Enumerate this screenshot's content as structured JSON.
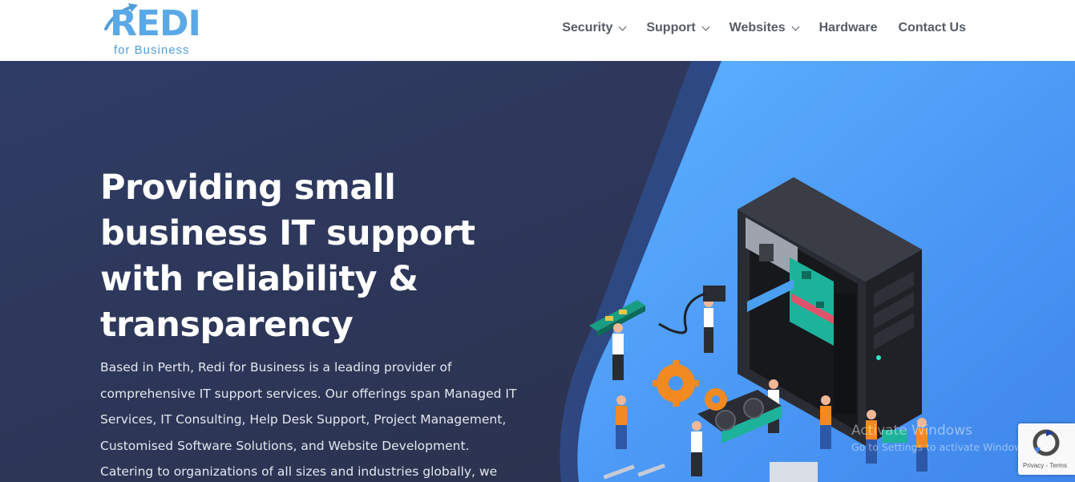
{
  "brand": {
    "name": "REDI",
    "tagline": "for Business"
  },
  "nav": {
    "items": [
      {
        "label": "Security",
        "has_dropdown": true
      },
      {
        "label": "Support",
        "has_dropdown": true
      },
      {
        "label": "Websites",
        "has_dropdown": true
      },
      {
        "label": "Hardware",
        "has_dropdown": false
      },
      {
        "label": "Contact Us",
        "has_dropdown": false
      }
    ]
  },
  "hero": {
    "title_lines": [
      "Providing small",
      "business IT support",
      "with reliability &",
      "transparency"
    ],
    "desc_lines": [
      "Based in Perth, Redi for Business is a leading provider of",
      "comprehensive IT support services. Our offerings span Managed IT",
      "Services, IT Consulting, Help Desk Support, Project Management,",
      "Customised Software Solutions, and Website Development.",
      "Catering to organizations of all sizes and industries globally, we"
    ]
  },
  "overlay": {
    "windows_watermark_title": "Activate Windows",
    "windows_watermark_sub": "Go to Settings to activate Windows.",
    "recaptcha_links": "Privacy - Terms"
  },
  "colors": {
    "brand_blue": "#5aa9e6",
    "hero_dark": "#2b3048",
    "hero_accent": "#4a96f5",
    "nav_text": "#555c66"
  },
  "icons": [
    "logo-arrow-icon",
    "chevron-down-icon",
    "server-illustration",
    "gear-icon",
    "recaptcha-icon"
  ]
}
